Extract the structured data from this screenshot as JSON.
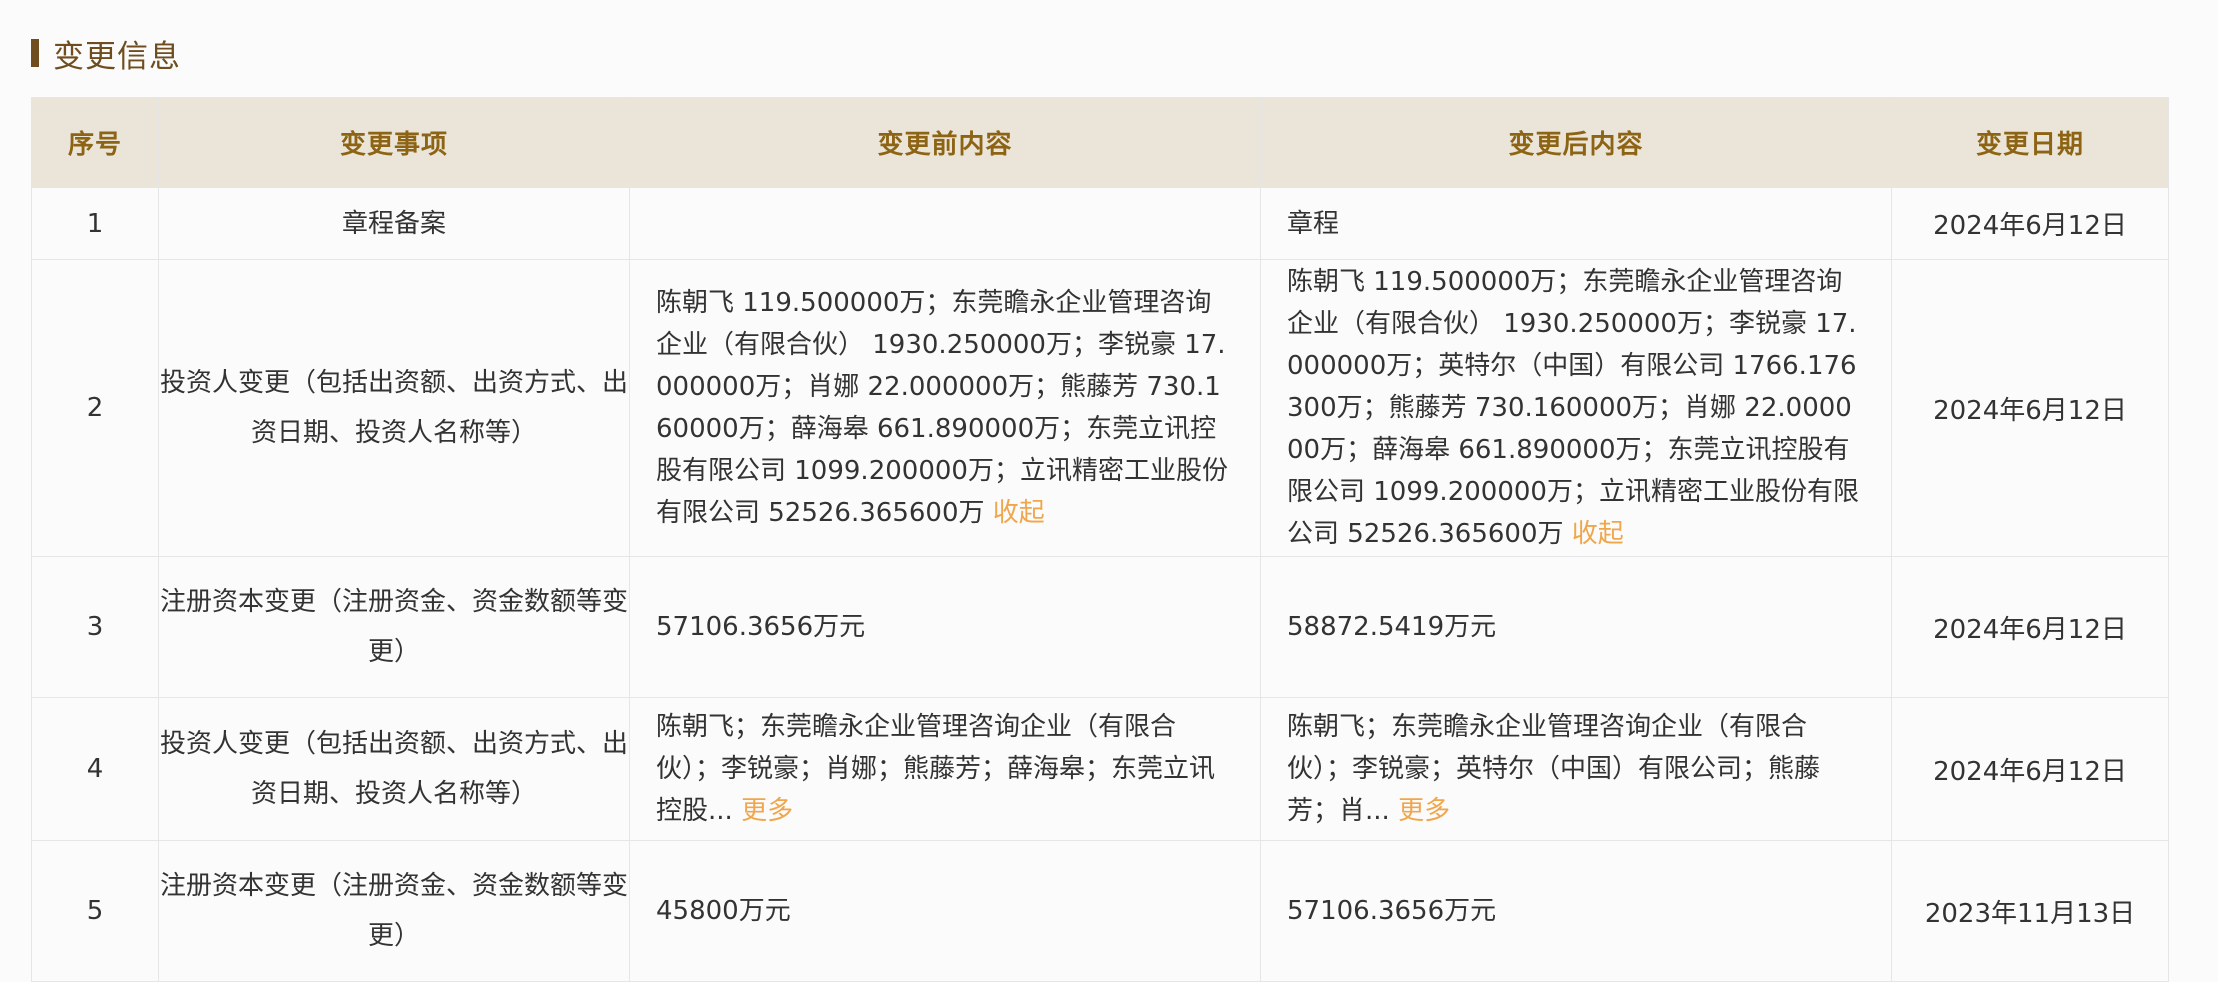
{
  "section": {
    "title": "变更信息"
  },
  "table": {
    "headers": [
      "序号",
      "变更事项",
      "变更前内容",
      "变更后内容",
      "变更日期"
    ],
    "rows": [
      {
        "no": "1",
        "item": "章程备案",
        "before": "",
        "after": "章程",
        "date": "2024年6月12日"
      },
      {
        "no": "2",
        "item": "投资人变更（包括出资额、出资方式、出资日期、投资人名称等）",
        "before": "陈朝飞 119.500000万；东莞瞻永企业管理咨询企业（有限合伙） 1930.250000万；李锐豪 17.000000万；肖娜 22.000000万；熊藤芳 730.160000万；薛海皋 661.890000万；东莞立讯控股有限公司 1099.200000万；立讯精密工业股份有限公司 52526.365600万",
        "before_link": "收起",
        "after": "陈朝飞 119.500000万；东莞瞻永企业管理咨询企业（有限合伙） 1930.250000万；李锐豪 17.000000万；英特尔（中国）有限公司 1766.176300万；熊藤芳 730.160000万；肖娜 22.000000万；薛海皋 661.890000万；东莞立讯控股有限公司 1099.200000万；立讯精密工业股份有限公司 52526.365600万",
        "after_link": "收起",
        "date": "2024年6月12日"
      },
      {
        "no": "3",
        "item": "注册资本变更（注册资金、资金数额等变更）",
        "before": "57106.3656万元",
        "after": "58872.5419万元",
        "date": "2024年6月12日"
      },
      {
        "no": "4",
        "item": "投资人变更（包括出资额、出资方式、出资日期、投资人名称等）",
        "before": "陈朝飞；东莞瞻永企业管理咨询企业（有限合伙）；李锐豪；肖娜；熊藤芳；薛海皋；东莞立讯控股...",
        "before_link": "更多",
        "after": "陈朝飞；东莞瞻永企业管理咨询企业（有限合伙）；李锐豪；英特尔（中国）有限公司；熊藤芳；肖...",
        "after_link": "更多",
        "date": "2024年6月12日"
      },
      {
        "no": "5",
        "item": "注册资本变更（注册资金、资金数额等变更）",
        "before": "45800万元",
        "after": "57106.3656万元",
        "date": "2023年11月13日"
      }
    ]
  }
}
